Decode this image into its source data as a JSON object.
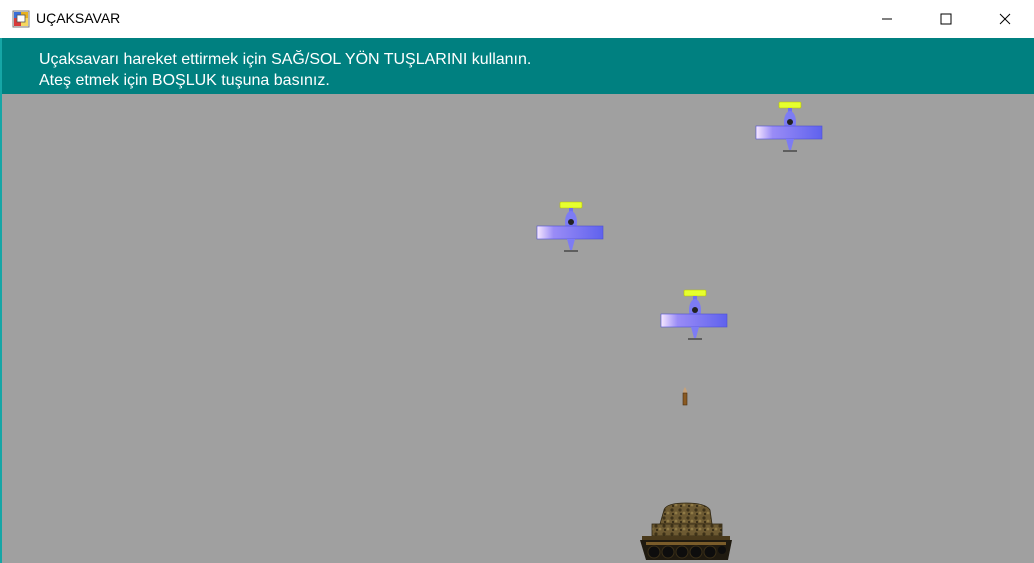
{
  "window": {
    "title": "UÇAKSAVAR",
    "icon": "app-icon",
    "controls": [
      "minimize-icon",
      "maximize-icon",
      "close-icon"
    ]
  },
  "game": {
    "instructions": {
      "line1": "Uçaksavarı hareket ettirmek için SAĞ/SOL YÖN TUŞLARINI kullanın.",
      "line2": "Ateş etmek için BOŞLUK tuşuna basınız."
    },
    "planes": [
      "plane-icon",
      "plane-icon",
      "plane-icon"
    ],
    "bullet": "bullet-icon",
    "player": "tank-icon"
  },
  "colors": {
    "banner": "#008080",
    "field": "#a0a0a0",
    "banner_text": "#ffffff",
    "plane_body": "#6f6ff2",
    "propeller": "#e6ff2e"
  }
}
